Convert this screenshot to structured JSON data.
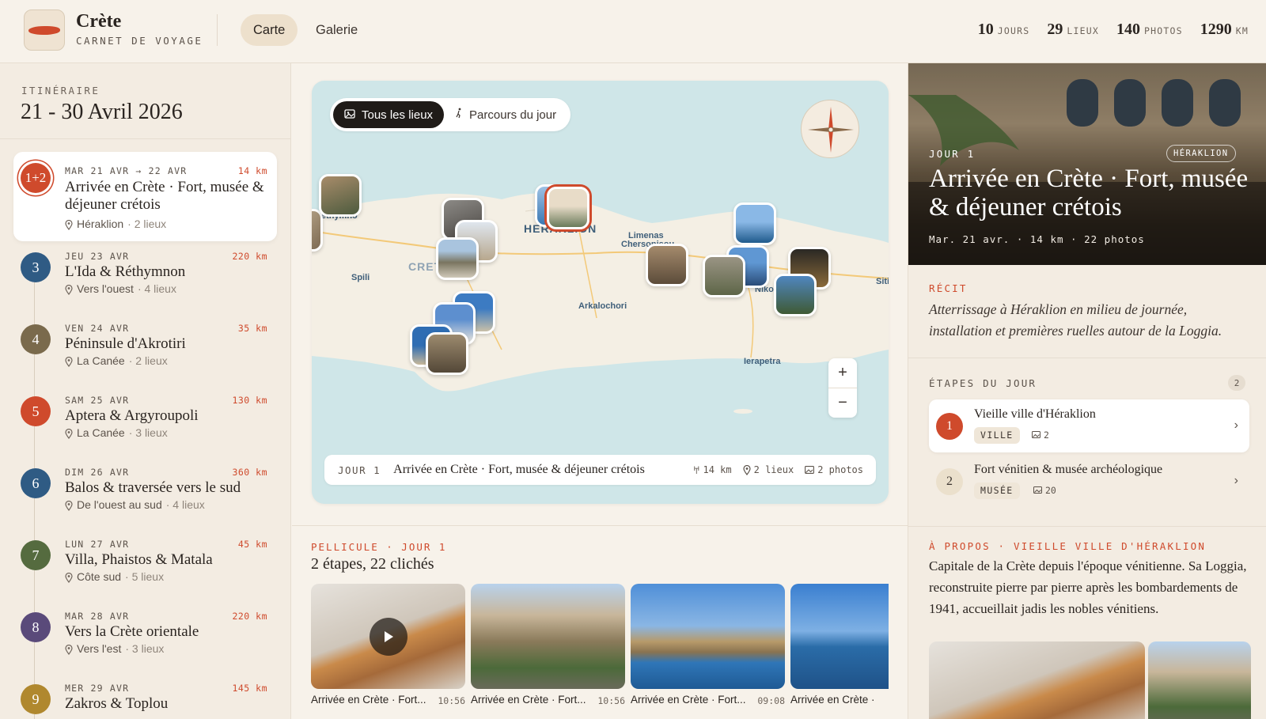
{
  "header": {
    "brand_title": "Crète",
    "brand_subtitle": "CARNET DE VOYAGE",
    "tabs": [
      {
        "label": "Carte",
        "active": true
      },
      {
        "label": "Galerie",
        "active": false
      }
    ],
    "stats": [
      {
        "value": "10",
        "label": "JOURS"
      },
      {
        "value": "29",
        "label": "LIEUX"
      },
      {
        "value": "140",
        "label": "PHOTOS"
      },
      {
        "value": "1290",
        "label": "KM"
      }
    ]
  },
  "itinerary": {
    "label": "ITINÉRAIRE",
    "dates": "21 - 30 Avril 2026",
    "days": [
      {
        "badge": "1+2",
        "date": "MAR 21 AVR → 22 AVR",
        "km": "14 km",
        "title": "Arrivée en Crète · Fort, musée & déjeuner crétois",
        "place": "Héraklion",
        "count": "· 2 lieux",
        "color": "#cf4a2c",
        "active": true
      },
      {
        "badge": "3",
        "date": "JEU 23 AVR",
        "km": "220 km",
        "title": "L'Ida & Réthymnon",
        "place": "Vers l'ouest",
        "count": "· 4 lieux",
        "color": "#2f5b84"
      },
      {
        "badge": "4",
        "date": "VEN 24 AVR",
        "km": "35 km",
        "title": "Péninsule d'Akrotiri",
        "place": "La Canée",
        "count": "· 2 lieux",
        "color": "#7a6a4c"
      },
      {
        "badge": "5",
        "date": "SAM 25 AVR",
        "km": "130 km",
        "title": "Aptera & Argyroupoli",
        "place": "La Canée",
        "count": "· 3 lieux",
        "color": "#cf4a2c"
      },
      {
        "badge": "6",
        "date": "DIM 26 AVR",
        "km": "360 km",
        "title": "Balos & traversée vers le sud",
        "place": "De l'ouest au sud",
        "count": "· 4 lieux",
        "color": "#2f5b84"
      },
      {
        "badge": "7",
        "date": "LUN 27 AVR",
        "km": "45 km",
        "title": "Villa, Phaistos & Matala",
        "place": "Côte sud",
        "count": "· 5 lieux",
        "color": "#556b3f"
      },
      {
        "badge": "8",
        "date": "MAR 28 AVR",
        "km": "220 km",
        "title": "Vers la Crète orientale",
        "place": "Vers l'est",
        "count": "· 3 lieux",
        "color": "#5a4a7a"
      },
      {
        "badge": "9",
        "date": "MER 29 AVR",
        "km": "145 km",
        "title": "Zakros & Toplou",
        "place": "",
        "count": "",
        "color": "#b0882e"
      }
    ]
  },
  "map": {
    "toggle_all": "Tous les lieux",
    "toggle_day": "Parcours du jour",
    "places": {
      "rethymno": "Rethymno",
      "heraklion": "HERAKLION",
      "crete": "CRETE",
      "spili": "Spili",
      "limenas": "Limenas",
      "chersonisou": "Chersonisou",
      "arkalochori": "Arkalochori",
      "ierapetra": "Ierapetra",
      "siti": "Siti",
      "nikolaos": "Nikolaos"
    },
    "zoom_in": "+",
    "zoom_out": "−",
    "footer": {
      "day": "JOUR 1",
      "title": "Arrivée en Crète · Fort, musée & déjeuner crétois",
      "km": "14 km",
      "lieux": "2 lieux",
      "photos": "2 photos"
    }
  },
  "pellicule": {
    "label": "PELLICULE · JOUR 1",
    "subtitle": "2 étapes, 22 clichés",
    "frames": [
      {
        "caption": "Arrivée en Crète · Fort...",
        "time": "10:56",
        "video": true
      },
      {
        "caption": "Arrivée en Crète · Fort...",
        "time": "10:56",
        "video": false
      },
      {
        "caption": "Arrivée en Crète · Fort...",
        "time": "09:08",
        "video": false
      },
      {
        "caption": "Arrivée en Crète ·",
        "time": "",
        "video": false
      }
    ]
  },
  "detail": {
    "hero_day": "JOUR 1",
    "hero_badge": "HÉRAKLION",
    "hero_title": "Arrivée en Crète · Fort, musée & déjeuner crétois",
    "hero_meta": "Mar. 21 avr. · 14 km · 22 photos",
    "recit_label": "RÉCIT",
    "recit_text": "Atterrissage à Héraklion en milieu de journée, installation et premières ruelles autour de la Loggia.",
    "etapes_label": "ÉTAPES DU JOUR",
    "etapes_count": "2",
    "etapes": [
      {
        "num": "1",
        "title": "Vieille ville d'Héraklion",
        "tag": "VILLE",
        "photos": "2",
        "active": true
      },
      {
        "num": "2",
        "title": "Fort vénitien & musée archéologique",
        "tag": "MUSÉE",
        "photos": "20",
        "active": false
      }
    ],
    "apropos_label": "À PROPOS · VIEILLE VILLE D'HÉRAKLION",
    "apropos_text": "Capitale de la Crète depuis l'époque vénitienne. Sa Loggia, reconstruite pierre par pierre après les bombardements de 1941, accueillait jadis les nobles vénitiens."
  },
  "colors": {
    "accent": "#cf4a2c",
    "background": "#f7f2ea",
    "panel": "#f3ece2",
    "sea": "#cfe6e8",
    "land": "#f4efe4"
  }
}
